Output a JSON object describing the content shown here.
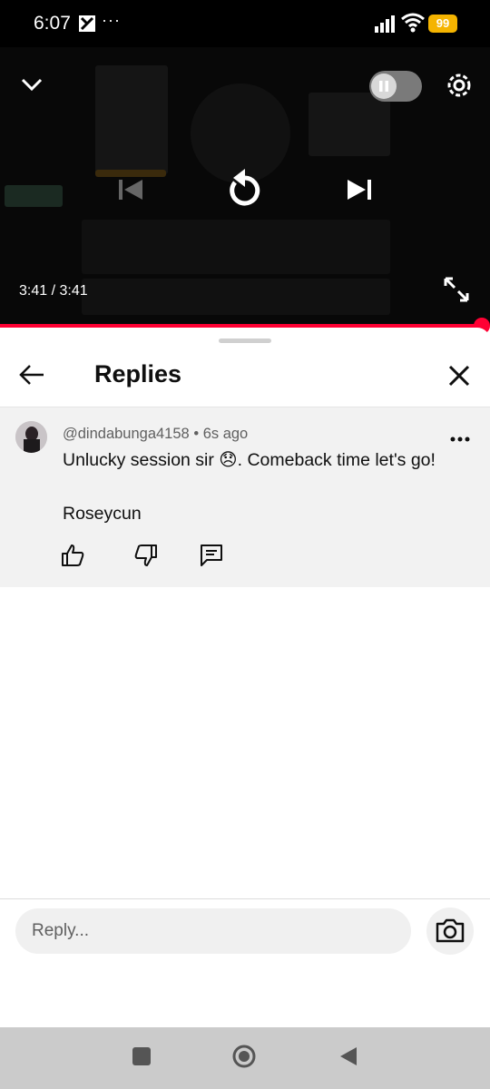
{
  "status_bar": {
    "time": "6:07",
    "more_indicator": "···",
    "battery": "99",
    "icons": [
      "app-notification-icon",
      "signal-icon",
      "wifi-icon",
      "battery-icon"
    ],
    "battery_color": "#f5b400"
  },
  "player": {
    "time_display": "3:41 / 3:41",
    "progress_fraction": 1.0,
    "accent_color": "#ff0033",
    "controls": [
      "collapse-icon",
      "autoplay-toggle",
      "settings-icon",
      "previous-icon",
      "replay-icon",
      "next-icon",
      "fullscreen-icon"
    ]
  },
  "replies": {
    "title": "Replies",
    "comment": {
      "author": "@dindabunga4158",
      "separator": "•",
      "time_ago": "6s ago",
      "line1": "Unlucky session sir 😞. Comeback time let's go!",
      "line2": "Roseycun"
    }
  },
  "composer": {
    "placeholder": "Reply..."
  }
}
